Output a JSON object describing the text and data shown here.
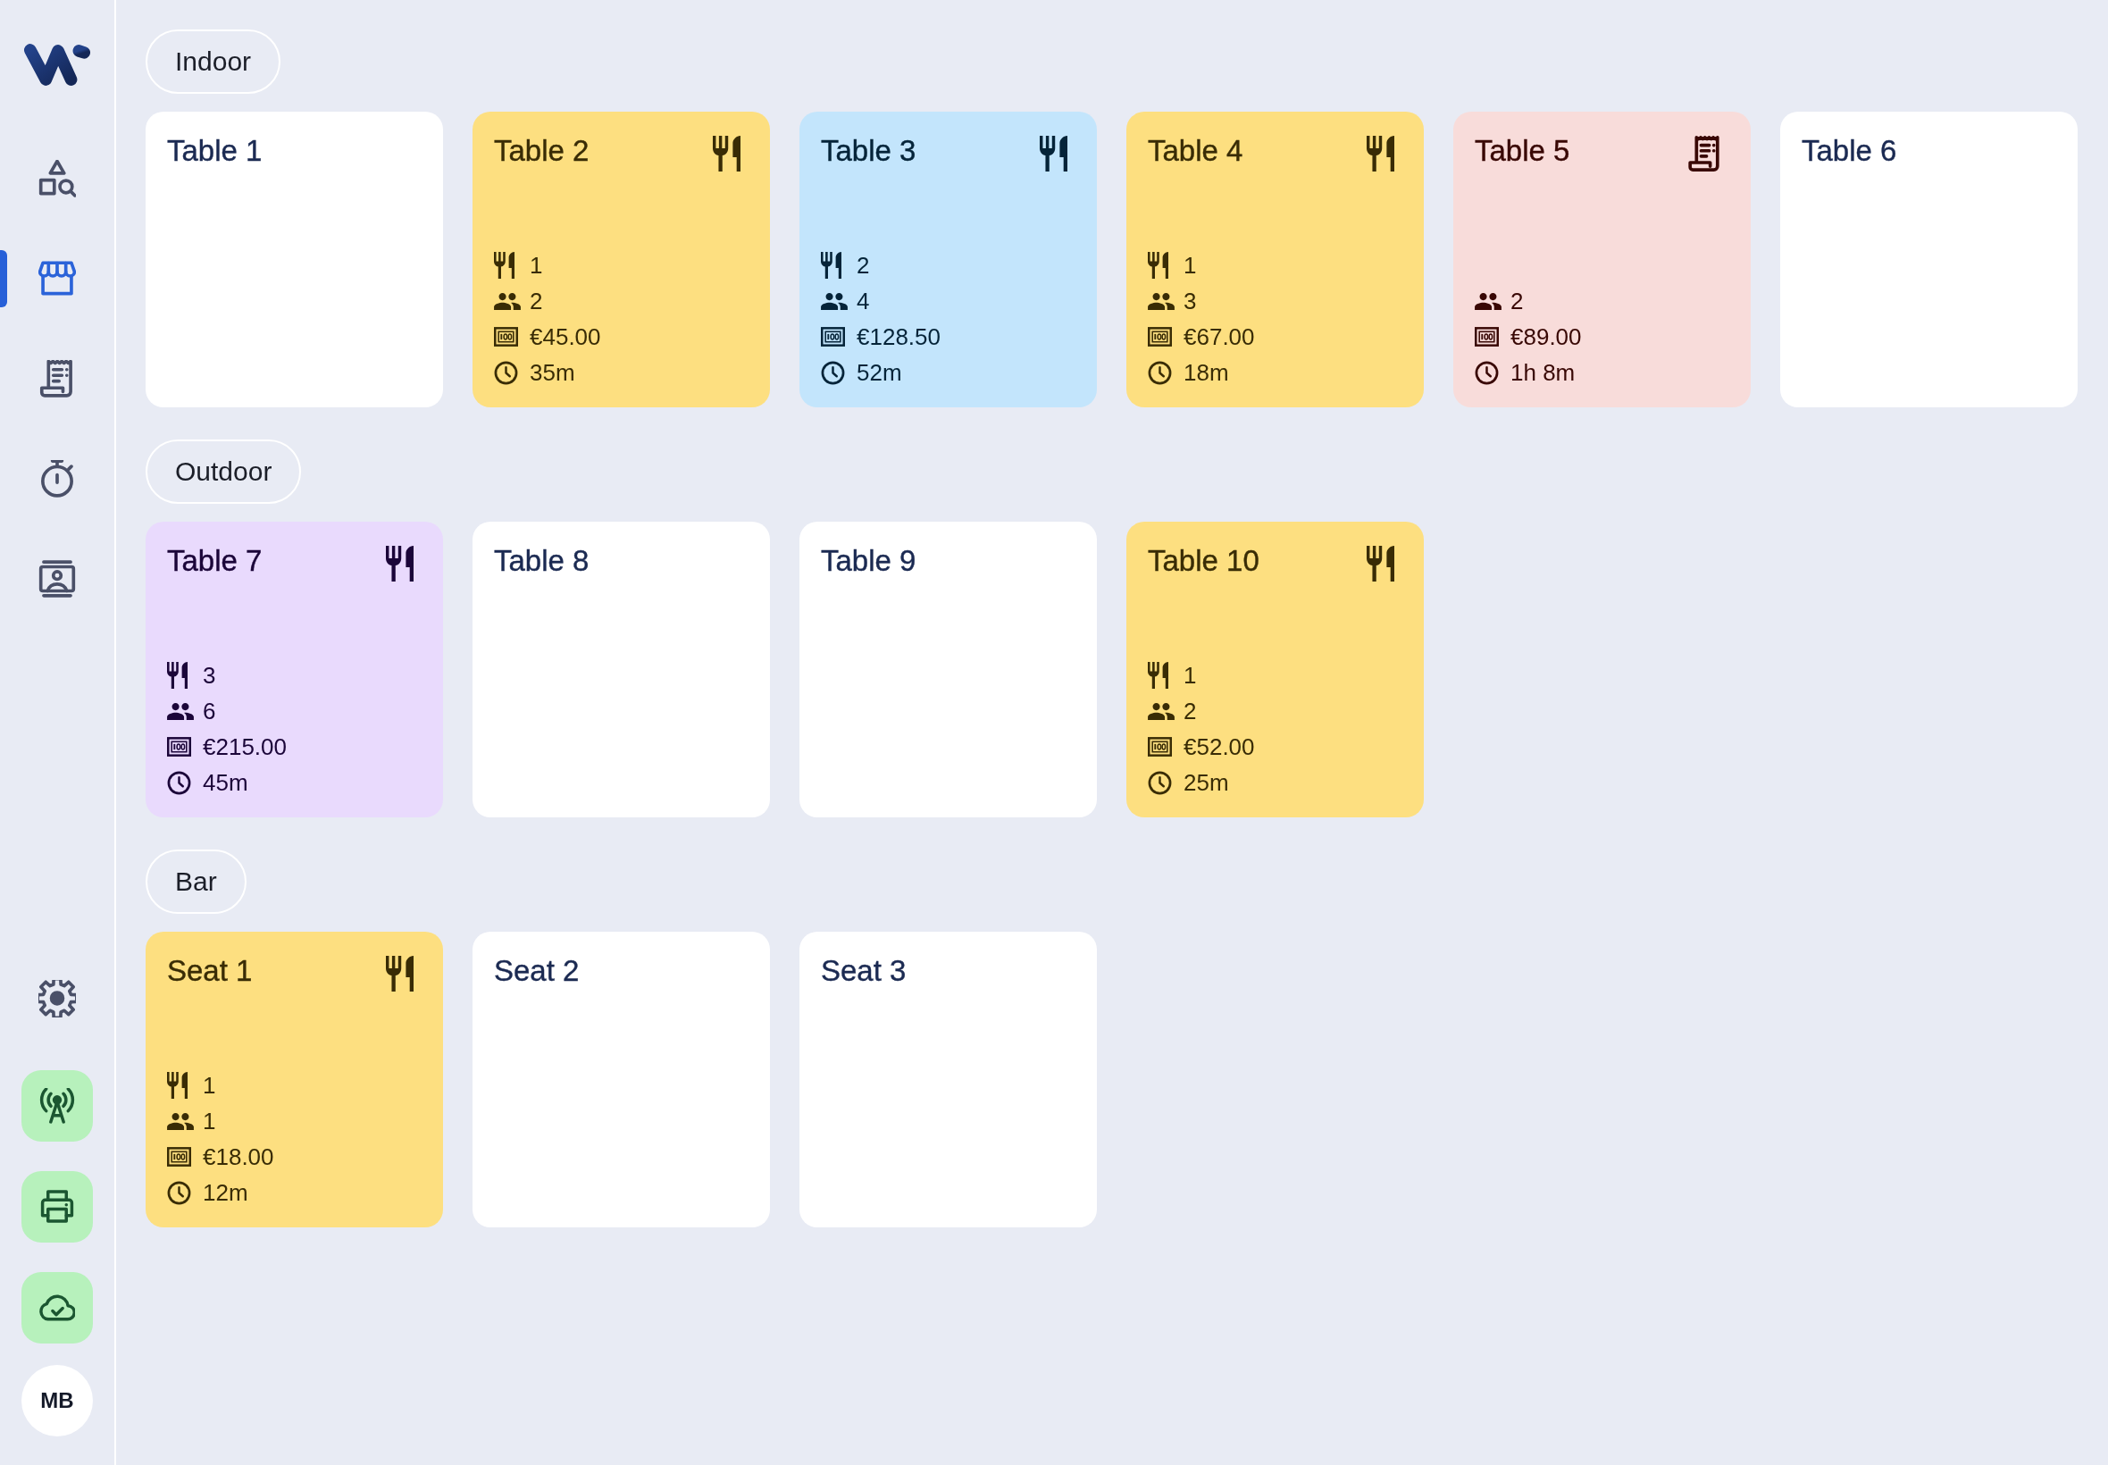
{
  "sidebar": {
    "nav": [
      {
        "kind": "catalog",
        "selected": false
      },
      {
        "kind": "tables",
        "selected": true
      },
      {
        "kind": "receipts",
        "selected": false
      },
      {
        "kind": "timer",
        "selected": false
      },
      {
        "kind": "staff",
        "selected": false
      }
    ],
    "footer_nav": [
      {
        "kind": "settings",
        "selected": false
      }
    ],
    "status": [
      {
        "kind": "network",
        "connected": true
      },
      {
        "kind": "printer",
        "connected": true
      },
      {
        "kind": "cloud",
        "connected": true
      }
    ],
    "user": {
      "initials": "MB"
    }
  },
  "zones": [
    {
      "name": "Indoor",
      "tables": [
        {
          "name": "Table 1",
          "kind": "free",
          "color": "#ffffff"
        },
        {
          "name": "Table 2",
          "kind": "dining",
          "color": "#fddf80",
          "details": [
            {
              "kind": "courses",
              "text": "1"
            },
            {
              "kind": "guests",
              "text": "2"
            },
            {
              "kind": "total",
              "text": "€45.00"
            },
            {
              "kind": "time",
              "text": "35m"
            }
          ]
        },
        {
          "name": "Table 3",
          "kind": "dining",
          "color": "#c3e5fc",
          "details": [
            {
              "kind": "courses",
              "text": "2"
            },
            {
              "kind": "guests",
              "text": "4"
            },
            {
              "kind": "total",
              "text": "€128.50"
            },
            {
              "kind": "time",
              "text": "52m"
            }
          ]
        },
        {
          "name": "Table 4",
          "kind": "dining",
          "color": "#fddf80",
          "details": [
            {
              "kind": "courses",
              "text": "1"
            },
            {
              "kind": "guests",
              "text": "3"
            },
            {
              "kind": "total",
              "text": "€67.00"
            },
            {
              "kind": "time",
              "text": "18m"
            }
          ]
        },
        {
          "name": "Table 5",
          "kind": "bill",
          "color": "#f8dcda",
          "details": [
            {
              "kind": "guests",
              "text": "2"
            },
            {
              "kind": "total",
              "text": "€89.00"
            },
            {
              "kind": "time",
              "text": "1h 8m"
            }
          ]
        },
        {
          "name": "Table 6",
          "kind": "free",
          "color": "#ffffff"
        }
      ]
    },
    {
      "name": "Outdoor",
      "tables": [
        {
          "name": "Table 7",
          "kind": "dining",
          "color": "#e9dafd",
          "details": [
            {
              "kind": "courses",
              "text": "3"
            },
            {
              "kind": "guests",
              "text": "6"
            },
            {
              "kind": "total",
              "text": "€215.00"
            },
            {
              "kind": "time",
              "text": "45m"
            }
          ]
        },
        {
          "name": "Table 8",
          "kind": "free",
          "color": "#ffffff"
        },
        {
          "name": "Table 9",
          "kind": "free",
          "color": "#ffffff"
        },
        {
          "name": "Table 10",
          "kind": "dining",
          "color": "#fddf80",
          "details": [
            {
              "kind": "courses",
              "text": "1"
            },
            {
              "kind": "guests",
              "text": "2"
            },
            {
              "kind": "total",
              "text": "€52.00"
            },
            {
              "kind": "time",
              "text": "25m"
            }
          ]
        }
      ]
    },
    {
      "name": "Bar",
      "tables": [
        {
          "name": "Seat 1",
          "kind": "dining",
          "color": "#fddf80",
          "details": [
            {
              "kind": "courses",
              "text": "1"
            },
            {
              "kind": "guests",
              "text": "1"
            },
            {
              "kind": "total",
              "text": "€18.00"
            },
            {
              "kind": "time",
              "text": "12m"
            }
          ]
        },
        {
          "name": "Seat 2",
          "kind": "free",
          "color": "#ffffff"
        },
        {
          "name": "Seat 3",
          "kind": "free",
          "color": "#ffffff"
        }
      ]
    }
  ]
}
